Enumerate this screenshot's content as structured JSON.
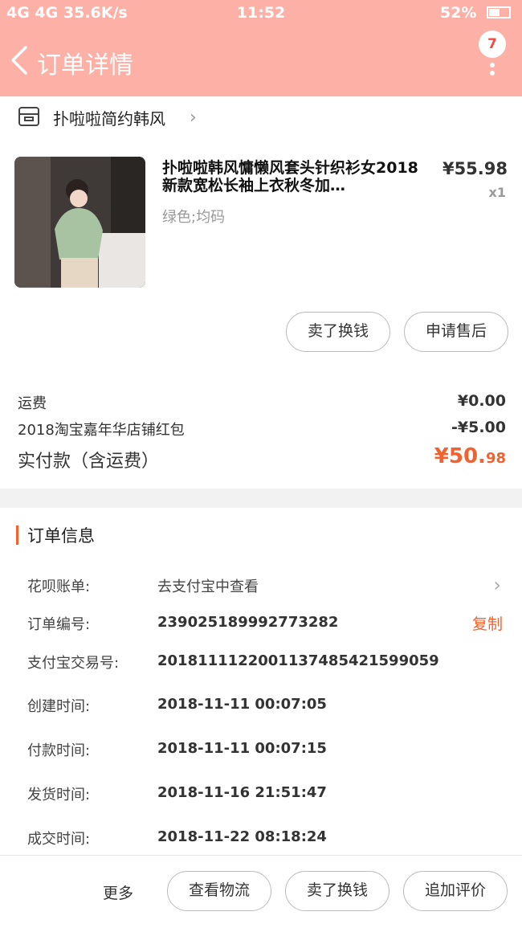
{
  "status_bar": {
    "signal": "4G 4G",
    "speed": "35.6K/s",
    "time": "11:52",
    "battery": "52%"
  },
  "header": {
    "title": "订单详情",
    "badge_count": "7",
    "bg_color": "#fcb0a6"
  },
  "shop": {
    "name": "扑啦啦简约韩风"
  },
  "product": {
    "title": "扑啦啦韩风慵懒风套头针织衫女2018新款宽松长袖上衣秋冬加…",
    "price": "¥55.98",
    "qty": "x1",
    "sku": "绿色;均码",
    "actions": [
      "卖了换钱",
      "申请售后"
    ]
  },
  "fees": {
    "shipping_label": "运费",
    "shipping_value": "¥0.00",
    "discount_label": "2018淘宝嘉年华店铺红包",
    "discount_value": "-¥5.00",
    "paid_label": "实付款（含运费）",
    "paid_int": "¥50.",
    "paid_dec": "98"
  },
  "order_info": {
    "title": "订单信息",
    "rows": [
      {
        "label": "花呗账单:",
        "value": "去支付宝中查看"
      },
      {
        "label": "订单编号:",
        "value": "239025189992773282"
      },
      {
        "label": "支付宝交易号:",
        "value": "2018111122001137485421599059"
      },
      {
        "label": "创建时间:",
        "value": "2018-11-11 00:07:05"
      },
      {
        "label": "付款时间:",
        "value": "2018-11-11 00:07:15"
      },
      {
        "label": "发货时间:",
        "value": "2018-11-16 21:51:47"
      },
      {
        "label": "成交时间:",
        "value": "2018-11-22 08:18:24"
      }
    ],
    "copy_label": "复制"
  },
  "bottom_bar": {
    "more": "更多",
    "buttons": [
      "查看物流",
      "卖了换钱",
      "追加评价"
    ]
  }
}
